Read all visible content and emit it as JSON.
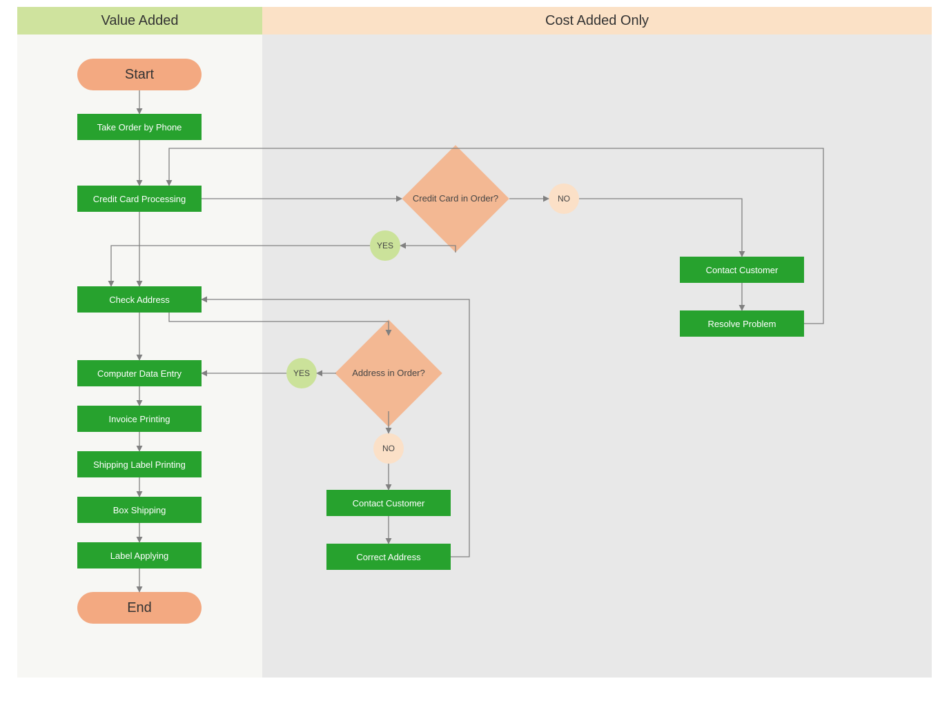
{
  "headers": {
    "left": "Value Added",
    "right": "Cost Added Only"
  },
  "start": "Start",
  "end": "End",
  "steps": {
    "take_order": "Take Order by Phone",
    "cc_proc": "Credit Card Processing",
    "check_addr": "Check Address",
    "data_entry": "Computer Data Entry",
    "invoice": "Invoice Printing",
    "ship_label": "Shipping Label Printing",
    "box_ship": "Box Shipping",
    "label_apply": "Label Applying",
    "contact1": "Contact Customer",
    "resolve": "Resolve Problem",
    "contact2": "Contact Customer",
    "correct": "Correct Address"
  },
  "decisions": {
    "cc_order": "Credit Card in Order?",
    "addr_order": "Address in Order?"
  },
  "labels": {
    "yes": "YES",
    "no": "NO"
  }
}
